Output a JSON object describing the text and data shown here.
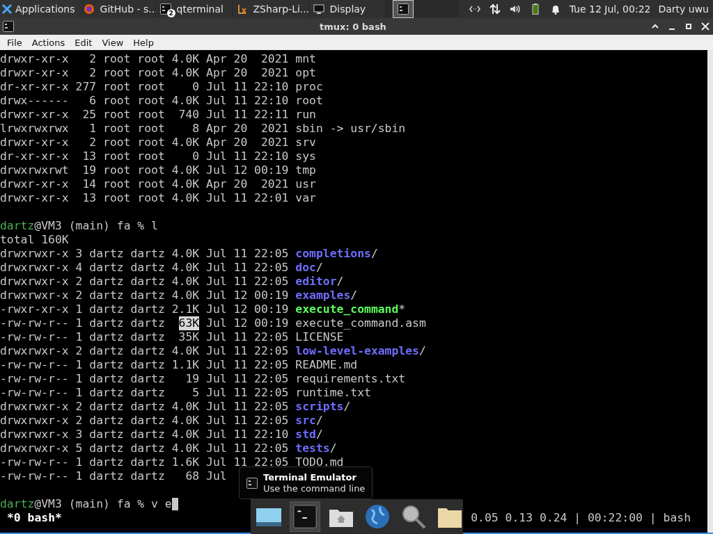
{
  "taskbar": {
    "menu": {
      "label": "Applications"
    },
    "tasks": [
      {
        "label": "GitHub - s...",
        "kind": "browser",
        "selected": false
      },
      {
        "label": "qterminal",
        "kind": "terminal",
        "badge": "2",
        "selected": false
      },
      {
        "label": "ZSharp-Li...",
        "kind": "document",
        "selected": false
      },
      {
        "label": "Display",
        "kind": "monitor",
        "selected": false
      },
      {
        "kind": "terminal",
        "selected": true
      }
    ],
    "clock": "Tue 12 Jul, 00:22",
    "user": "Darty uwu"
  },
  "window": {
    "title": "tmux: 0 bash"
  },
  "menu": [
    "File",
    "Actions",
    "Edit",
    "View",
    "Help"
  ],
  "terminal": {
    "blocks": [
      {
        "lines": [
          {
            "segments": [
              {
                "kind": "plain",
                "text": "drwxr-xr-x   2 root root 4.0K Apr 20  2021 mnt"
              }
            ]
          },
          {
            "segments": [
              {
                "kind": "plain",
                "text": "drwxr-xr-x   2 root root 4.0K Apr 20  2021 opt"
              }
            ]
          },
          {
            "segments": [
              {
                "kind": "plain",
                "text": "dr-xr-xr-x 277 root root    0 Jul 11 22:10 proc"
              }
            ]
          },
          {
            "segments": [
              {
                "kind": "plain",
                "text": "drwx------   6 root root 4.0K Jul 11 22:10 root"
              }
            ]
          },
          {
            "segments": [
              {
                "kind": "plain",
                "text": "drwxr-xr-x  25 root root  740 Jul 11 22:11 run"
              }
            ]
          },
          {
            "segments": [
              {
                "kind": "plain",
                "text": "lrwxrwxrwx   1 root root    8 Apr 20  2021 sbin -> usr/sbin"
              }
            ]
          },
          {
            "segments": [
              {
                "kind": "plain",
                "text": "drwxr-xr-x   2 root root 4.0K Apr 20  2021 srv"
              }
            ]
          },
          {
            "segments": [
              {
                "kind": "plain",
                "text": "dr-xr-xr-x  13 root root    0 Jul 11 22:10 sys"
              }
            ]
          },
          {
            "segments": [
              {
                "kind": "plain",
                "text": "drwxrwxrwt  19 root root 4.0K Jul 12 00:19 tmp"
              }
            ]
          },
          {
            "segments": [
              {
                "kind": "plain",
                "text": "drwxr-xr-x  14 root root 4.0K Apr 20  2021 usr"
              }
            ]
          },
          {
            "segments": [
              {
                "kind": "plain",
                "text": "drwxr-xr-x  13 root root 4.0K Jul 11 22:01 var"
              }
            ]
          }
        ]
      },
      {
        "lines": [
          {
            "segments": [
              {
                "kind": "user",
                "text": "dartz"
              },
              {
                "kind": "plain",
                "text": "@VM3 (main) fa % l"
              }
            ]
          },
          {
            "segments": [
              {
                "kind": "plain",
                "text": "total 160K"
              }
            ]
          },
          {
            "segments": [
              {
                "kind": "plain",
                "text": "drwxrwxr-x 3 dartz dartz 4.0K Jul 11 22:05 "
              },
              {
                "kind": "dir",
                "text": "completions"
              },
              {
                "kind": "plain",
                "text": "/"
              }
            ]
          },
          {
            "segments": [
              {
                "kind": "plain",
                "text": "drwxrwxr-x 4 dartz dartz 4.0K Jul 11 22:05 "
              },
              {
                "kind": "dir",
                "text": "doc"
              },
              {
                "kind": "plain",
                "text": "/"
              }
            ]
          },
          {
            "segments": [
              {
                "kind": "plain",
                "text": "drwxrwxr-x 2 dartz dartz 4.0K Jul 11 22:05 "
              },
              {
                "kind": "dir",
                "text": "editor"
              },
              {
                "kind": "plain",
                "text": "/"
              }
            ]
          },
          {
            "segments": [
              {
                "kind": "plain",
                "text": "drwxrwxr-x 2 dartz dartz 4.0K Jul 12 00:19 "
              },
              {
                "kind": "dir",
                "text": "examples"
              },
              {
                "kind": "plain",
                "text": "/"
              }
            ]
          },
          {
            "segments": [
              {
                "kind": "plain",
                "text": "-rwxr-xr-x 1 dartz dartz 2.1K Jul 12 00:19 "
              },
              {
                "kind": "exec",
                "text": "execute_command"
              },
              {
                "kind": "plain",
                "text": "*"
              }
            ]
          },
          {
            "segments": [
              {
                "kind": "plain",
                "text": "-rw-rw-r-- 1 dartz dartz  "
              },
              {
                "kind": "highlight",
                "text": "63K"
              },
              {
                "kind": "plain",
                "text": " Jul 12 00:19 execute_command.asm"
              }
            ]
          },
          {
            "segments": [
              {
                "kind": "plain",
                "text": "-rw-rw-r-- 1 dartz dartz  35K Jul 11 22:05 LICENSE"
              }
            ]
          },
          {
            "segments": [
              {
                "kind": "plain",
                "text": "drwxrwxr-x 2 dartz dartz 4.0K Jul 11 22:05 "
              },
              {
                "kind": "dir",
                "text": "low-level-examples"
              },
              {
                "kind": "plain",
                "text": "/"
              }
            ]
          },
          {
            "segments": [
              {
                "kind": "plain",
                "text": "-rw-rw-r-- 1 dartz dartz 1.1K Jul 11 22:05 README.md"
              }
            ]
          },
          {
            "segments": [
              {
                "kind": "plain",
                "text": "-rw-rw-r-- 1 dartz dartz   19 Jul 11 22:05 requirements.txt"
              }
            ]
          },
          {
            "segments": [
              {
                "kind": "plain",
                "text": "-rw-rw-r-- 1 dartz dartz    5 Jul 11 22:05 runtime.txt"
              }
            ]
          },
          {
            "segments": [
              {
                "kind": "plain",
                "text": "drwxrwxr-x 2 dartz dartz 4.0K Jul 11 22:05 "
              },
              {
                "kind": "dir",
                "text": "scripts"
              },
              {
                "kind": "plain",
                "text": "/"
              }
            ]
          },
          {
            "segments": [
              {
                "kind": "plain",
                "text": "drwxrwxr-x 2 dartz dartz 4.0K Jul 11 22:05 "
              },
              {
                "kind": "dir",
                "text": "src"
              },
              {
                "kind": "plain",
                "text": "/"
              }
            ]
          },
          {
            "segments": [
              {
                "kind": "plain",
                "text": "drwxrwxr-x 3 dartz dartz 4.0K Jul 11 22:10 "
              },
              {
                "kind": "dir",
                "text": "std"
              },
              {
                "kind": "plain",
                "text": "/"
              }
            ]
          },
          {
            "segments": [
              {
                "kind": "plain",
                "text": "drwxrwxr-x 5 dartz dartz 4.0K Jul 11 22:05 "
              },
              {
                "kind": "dir",
                "text": "tests"
              },
              {
                "kind": "plain",
                "text": "/"
              }
            ]
          },
          {
            "segments": [
              {
                "kind": "plain",
                "text": "-rw-rw-r-- 1 dartz dartz 1.6K Jul 11 22:05 TODO.md"
              }
            ]
          },
          {
            "segments": [
              {
                "kind": "plain",
                "text": "-rw-rw-r-- 1 dartz dartz   68 Jul"
              }
            ]
          }
        ]
      },
      {
        "lines": [
          {
            "segments": [
              {
                "kind": "user",
                "text": "dartz"
              },
              {
                "kind": "plain",
                "text": "@VM3 (main) fa % v e"
              }
            ]
          }
        ]
      }
    ],
    "status": {
      "left": "*0 bash*",
      "right": "0.05 0.13 0.24 | 00:22:00 | bash"
    }
  },
  "tooltip": {
    "title": "Terminal Emulator",
    "text": "Use the command line"
  },
  "dock": [
    {
      "kind": "desktop",
      "selected": false
    },
    {
      "kind": "terminal",
      "selected": true
    },
    {
      "kind": "home",
      "selected": false
    },
    {
      "kind": "globe",
      "selected": false
    },
    {
      "kind": "search",
      "selected": false
    },
    {
      "kind": "folder",
      "selected": false
    }
  ]
}
